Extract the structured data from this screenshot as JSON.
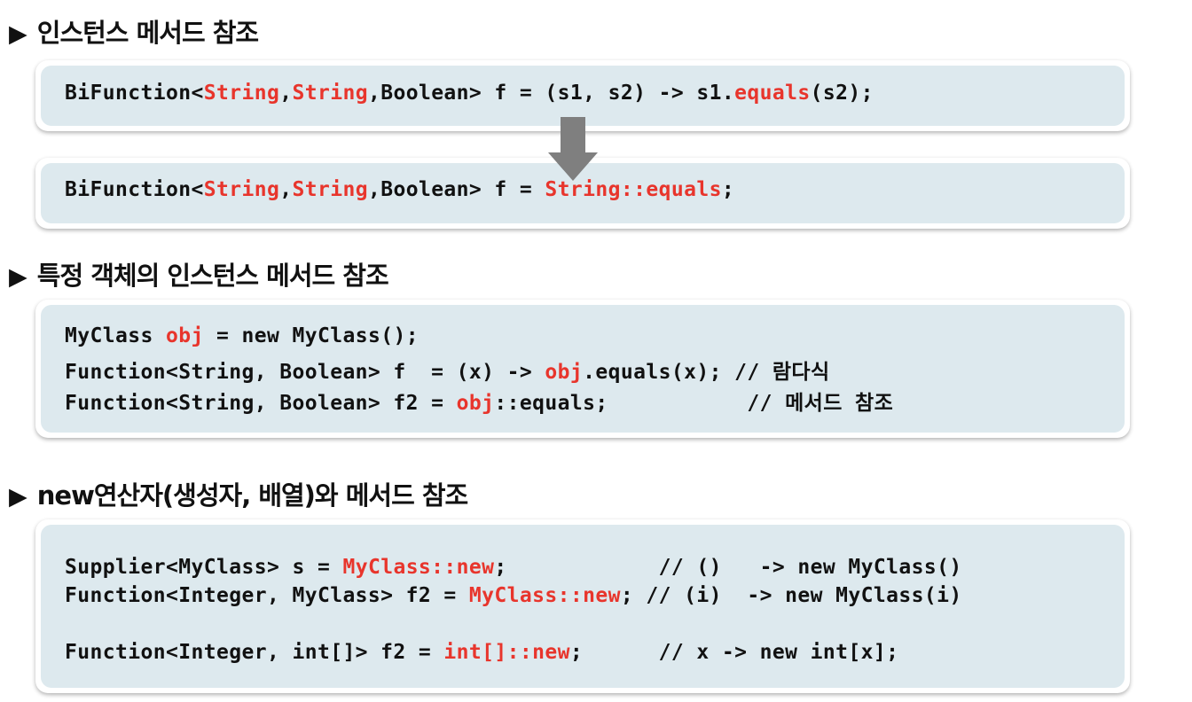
{
  "sections": [
    {
      "title": "인스턴스 메서드 참조"
    },
    {
      "title": "특정 객체의 인스턴스 메서드 참조"
    },
    {
      "title": "new연산자(생성자, 배열)와 메서드 참조"
    }
  ],
  "heading_marker": "▶",
  "colors": {
    "highlight": "#e8352c",
    "box_fill": "#dde9ee",
    "arrow": "#7f7f7f"
  },
  "box1": {
    "p1": "BiFunction<",
    "p2": "String",
    "p3": ",",
    "p4": "String",
    "p5": ",Boolean> f = (s1, s2) -> s1.",
    "p6": "equals",
    "p7": "(s2);"
  },
  "box2": {
    "p1": "BiFunction<",
    "p2": "String",
    "p3": ",",
    "p4": "String",
    "p5": ",Boolean> f = ",
    "p6": "String::equals",
    "p7": ";"
  },
  "box3": {
    "line1": {
      "a": "MyClass ",
      "b": "obj",
      "c": " = new MyClass();"
    },
    "line2": {
      "a": "Function<String, Boolean> f  = (x) -> ",
      "b": "obj",
      "c": ".equals(x); ",
      "comment": "// 람다식"
    },
    "line3": {
      "a": "Function<String, Boolean> f2 = ",
      "b": "obj",
      "c": "::equals;           ",
      "comment": "// 메서드 참조"
    }
  },
  "box4": {
    "line1": {
      "a": "Supplier<MyClass> s = ",
      "b": "MyClass::new",
      "c": ";            ",
      "comment": "// ()   -> new MyClass()"
    },
    "line2": {
      "a": "Function<Integer, MyClass> f2 = ",
      "b": "MyClass::new",
      "c": "; ",
      "comment": "// (i)  -> new MyClass(i)"
    },
    "line3": {
      "a": "Function<Integer, int[]> f2 = ",
      "b": "int[]::new",
      "c": ";      ",
      "comment": "// x -> new int[x];"
    }
  }
}
